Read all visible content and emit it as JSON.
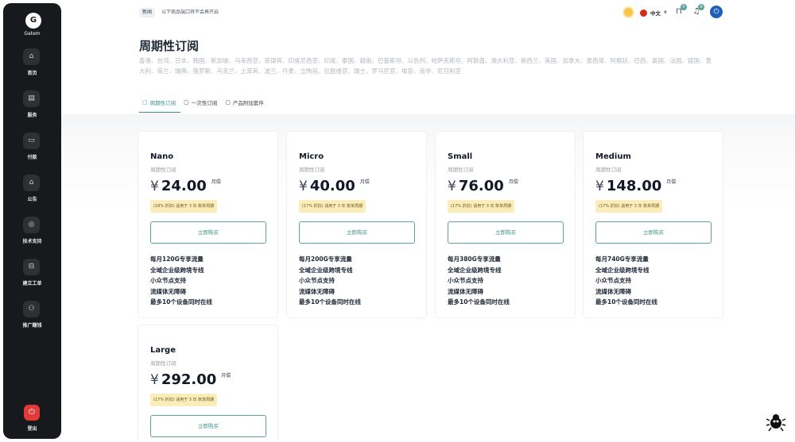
{
  "sidebar": {
    "logo_letter": "G",
    "app_name": "Gatem",
    "items": [
      {
        "label": "首页",
        "icon": "home-icon",
        "glyph": "⌂"
      },
      {
        "label": "服务",
        "icon": "shop-icon",
        "glyph": "▤"
      },
      {
        "label": "付款",
        "icon": "card-icon",
        "glyph": "▭"
      },
      {
        "label": "公告",
        "icon": "announcement-icon",
        "glyph": "⌂"
      },
      {
        "label": "技术支持",
        "icon": "globe-icon",
        "glyph": "◎"
      },
      {
        "label": "建立工单",
        "icon": "ticket-icon",
        "glyph": "⊟"
      },
      {
        "label": "推广赚钱",
        "icon": "user-add-icon",
        "glyph": "⚇"
      }
    ],
    "logout_label": "登出"
  },
  "topbar": {
    "notice_tag": "新闻",
    "notice_text": "以下商品端口将不会再开启",
    "language": "中文",
    "cart_badge": "0",
    "bell_badge": "0"
  },
  "header": {
    "title": "周期性订阅",
    "regions": "香港、台湾、日本、韩国、新加坡、马来西亚、菲律宾、印度尼西亚、印度、泰国、越南、巴基斯坦、以色列、哈萨克斯坦、阿联酋、澳大利亚、新西兰、美国、加拿大、墨西哥、阿根廷、巴西、英国、法国、德国、意大利、荷兰、瑞典、俄罗斯、乌克兰、土耳其、波兰、丹麦、立陶宛、拉脱维亚、瑞士、罗马尼亚、埃及、南非、尼日利亚"
  },
  "tabs": [
    {
      "label": "周期性订阅",
      "active": true
    },
    {
      "label": "一次性订阅",
      "active": false
    },
    {
      "label": "产品附加套件",
      "active": false
    }
  ],
  "plans": [
    {
      "name": "Nano",
      "subtitle": "周期性订阅",
      "currency": "¥",
      "price": "24.00",
      "unit": "月偿",
      "discount": "(18% 折扣) 适用于 3 年 账单周期",
      "buy_label": "立即购买",
      "features": [
        "每月120G专享流量",
        "全域企业级跨境专线",
        "小众节点支持",
        "流媒体无障碍",
        "最多10个设备同时在线"
      ]
    },
    {
      "name": "Micro",
      "subtitle": "周期性订阅",
      "currency": "¥",
      "price": "40.00",
      "unit": "月偿",
      "discount": "(17% 折扣) 适用于 3 年 账单周期",
      "buy_label": "立即购买",
      "features": [
        "每月200G专享流量",
        "全域企业级跨境专线",
        "小众节点支持",
        "流媒体无障碍",
        "最多10个设备同时在线"
      ]
    },
    {
      "name": "Small",
      "subtitle": "周期性订阅",
      "currency": "¥",
      "price": "76.00",
      "unit": "月偿",
      "discount": "(17% 折扣) 适用于 3 年 账单周期",
      "buy_label": "立即购买",
      "features": [
        "每月380G专享流量",
        "全域企业级跨境专线",
        "小众节点支持",
        "流媒体无障碍",
        "最多10个设备同时在线"
      ]
    },
    {
      "name": "Medium",
      "subtitle": "周期性订阅",
      "currency": "¥",
      "price": "148.00",
      "unit": "月偿",
      "discount": "(17% 折扣) 适用于 3 年 账单周期",
      "buy_label": "立即购买",
      "features": [
        "每月740G专享流量",
        "全域企业级跨境专线",
        "小众节点支持",
        "流媒体无障碍",
        "最多10个设备同时在线"
      ]
    },
    {
      "name": "Large",
      "subtitle": "周期性订阅",
      "currency": "¥",
      "price": "292.00",
      "unit": "月偿",
      "discount": "(17% 折扣) 适用于 3 年 账单周期",
      "buy_label": "立即购买",
      "features": []
    }
  ],
  "colors": {
    "accent": "#3d9288",
    "sidebar": "#17191c",
    "logout": "#e03a3a",
    "discount_bg": "#fbedba"
  }
}
